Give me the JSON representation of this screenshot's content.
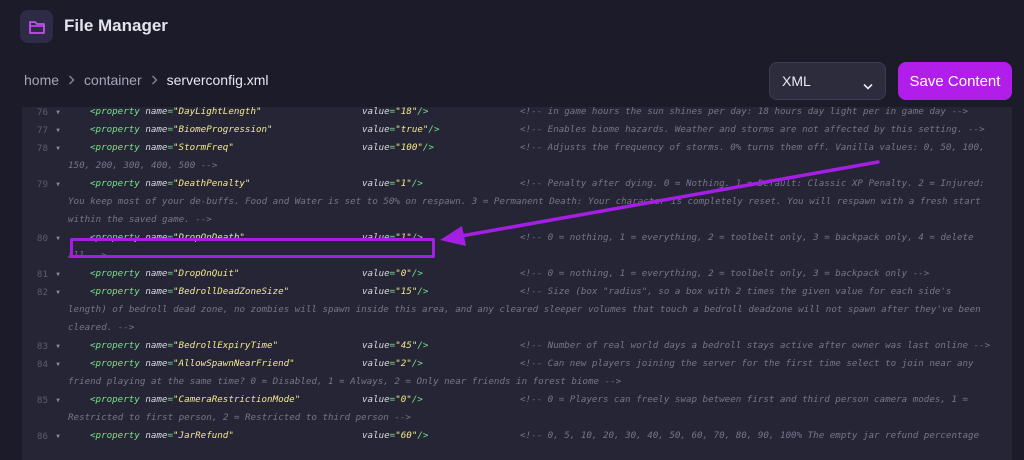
{
  "app": {
    "title": "File Manager",
    "logo_icon": "folder-icon"
  },
  "breadcrumb": [
    "home",
    "container",
    "serverconfig.xml"
  ],
  "format_select": {
    "value": "XML"
  },
  "save_button": {
    "label": "Save Content"
  },
  "colors": {
    "accent": "#b11de9",
    "background": "#1c1b2a",
    "editor_bg": "#252536",
    "tag": "#78e38a",
    "string": "#f4e98c",
    "comment": "#777689"
  },
  "editor": {
    "lines": [
      {
        "num": "76",
        "name": "\"DayLightLength\"",
        "value": "\"18\"",
        "comment": [
          "<!-- in game hours the sun shines per day: 18 hours day light per in game day -->"
        ]
      },
      {
        "num": "77",
        "name": "\"BiomeProgression\"",
        "value": "\"true\"",
        "comment": [
          "<!-- Enables biome hazards. Weather and storms are not affected by this setting. -->"
        ]
      },
      {
        "num": "78",
        "name": "\"StormFreq\"",
        "value": "\"100\"",
        "comment": [
          "<!-- Adjusts the frequency of storms. 0% turns them off. Vanilla values: 0, 50, 100,",
          "150, 200, 300, 400, 500 -->"
        ]
      },
      {
        "num": "79",
        "name": "\"DeathPenalty\"",
        "value": "\"1\"",
        "comment": [
          "<!-- Penalty after dying. 0 = Nothing. 1 = Default: Classic XP Penalty.  2 = Injured:",
          "You keep most of your de-buffs. Food and Water is set to 50% on respawn. 3 = Permanent Death: Your character is completely reset. You will respawn with a fresh start",
          "within the saved game. -->"
        ]
      },
      {
        "num": "80",
        "name": "\"DropOnDeath\"",
        "value": "\"1\"",
        "comment": [
          "<!-- 0 = nothing, 1 = everything, 2 = toolbelt only, 3 = backpack only, 4 = delete",
          "all -->"
        ]
      },
      {
        "num": "81",
        "name": "\"DropOnQuit\"",
        "value": "\"0\"",
        "comment": [
          "<!-- 0 = nothing, 1 = everything, 2 = toolbelt only, 3 = backpack only -->"
        ]
      },
      {
        "num": "82",
        "name": "\"BedrollDeadZoneSize\"",
        "value": "\"15\"",
        "comment": [
          "<!-- Size (box \"radius\", so a box with 2 times the given value for each side's",
          "length) of bedroll dead zone, no zombies will spawn inside this area, and any cleared sleeper volumes that touch a bedroll deadzone will not spawn after they've been",
          "cleared. -->"
        ]
      },
      {
        "num": "83",
        "name": "\"BedrollExpiryTime\"",
        "value": "\"45\"",
        "comment": [
          "<!-- Number of real world days a bedroll stays active after owner was last online -->"
        ]
      },
      {
        "num": "84",
        "name": "\"AllowSpawnNearFriend\"",
        "value": "\"2\"",
        "comment": [
          "<!-- Can new players joining the server for the first time select to join near any",
          "friend playing at the same time? 0 = Disabled, 1 = Always, 2 = Only near friends in forest biome -->"
        ]
      },
      {
        "num": "85",
        "name": "\"CameraRestrictionMode\"",
        "value": "\"0\"",
        "comment": [
          "<!-- 0 = Players can freely swap between first and third person camera modes, 1 =",
          "Restricted to first person, 2 = Restricted to third person -->"
        ]
      },
      {
        "num": "86",
        "name": "\"JarRefund\"",
        "value": "\"60\"",
        "comment": [
          "<!-- 0, 5, 10, 20, 30, 40, 50, 60, 70, 80, 90, 100% The empty jar refund percentage"
        ]
      }
    ]
  }
}
